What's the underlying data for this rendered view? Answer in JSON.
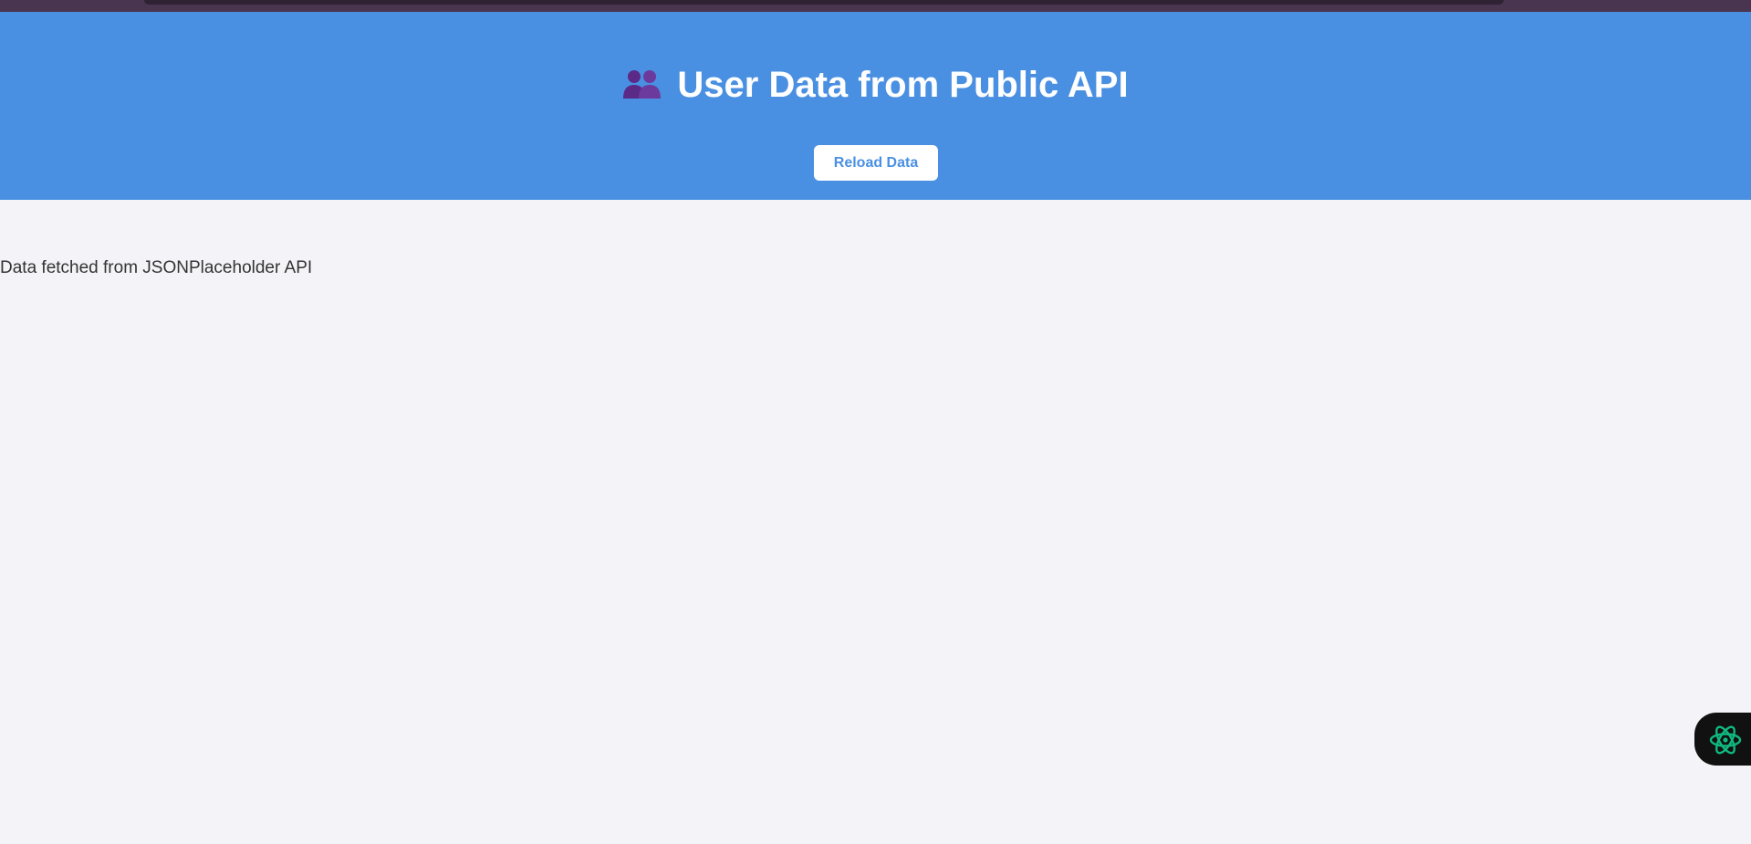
{
  "header": {
    "icon": "users-icon",
    "title": "User Data from Public API",
    "reload_label": "Reload Data"
  },
  "main": {
    "source_note": "Data fetched from JSONPlaceholder API"
  },
  "assistant": {
    "icon": "atom-icon"
  },
  "colors": {
    "header_bg": "#4a90e2",
    "page_bg": "#f4f4f8",
    "button_text": "#4a90e2",
    "fab_bg": "#111111",
    "fab_icon": "#10b981"
  }
}
